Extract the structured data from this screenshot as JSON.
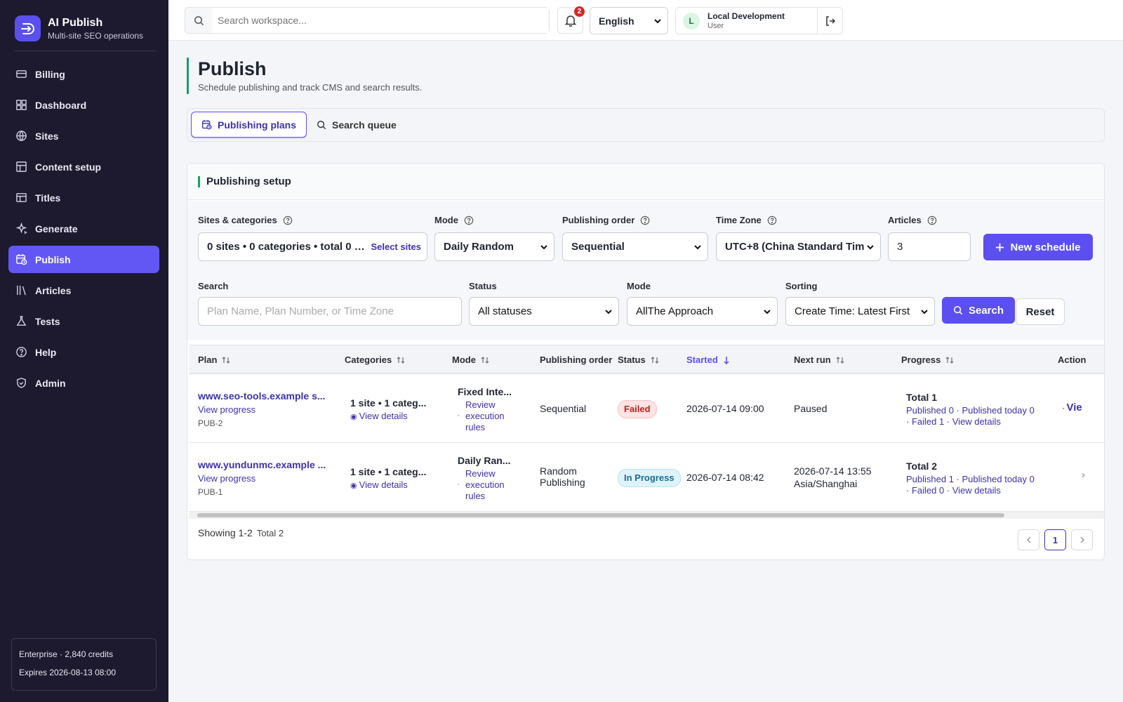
{
  "app": {
    "title": "AI Publish",
    "subtitle": "Multi-site SEO operations"
  },
  "sidebar": {
    "items": [
      {
        "label": "Billing",
        "icon": "billing-icon"
      },
      {
        "label": "Dashboard",
        "icon": "dashboard-icon"
      },
      {
        "label": "Sites",
        "icon": "globe-icon"
      },
      {
        "label": "Content setup",
        "icon": "layout-icon"
      },
      {
        "label": "Titles",
        "icon": "table-icon"
      },
      {
        "label": "Generate",
        "icon": "sparkle-icon"
      },
      {
        "label": "Publish",
        "icon": "calendar-clock-icon",
        "active": true
      },
      {
        "label": "Articles",
        "icon": "library-icon"
      },
      {
        "label": "Tests",
        "icon": "flask-icon"
      },
      {
        "label": "Help",
        "icon": "help-icon"
      },
      {
        "label": "Admin",
        "icon": "shield-icon"
      }
    ],
    "plan": {
      "line1": "Enterprise · 2,840 credits",
      "line2": "Expires 2026-08-13 08:00"
    }
  },
  "topbar": {
    "search_placeholder": "Search workspace...",
    "notifications_count": "2",
    "language": "English",
    "user": {
      "initial": "L",
      "name": "Local Development",
      "role": "User"
    }
  },
  "page": {
    "title": "Publish",
    "subtitle": "Schedule publishing and track CMS and search results."
  },
  "tabs": [
    {
      "label": "Publishing plans",
      "active": true
    },
    {
      "label": "Search queue",
      "active": false
    }
  ],
  "setup": {
    "title": "Publishing setup",
    "sites_label": "Sites & categories",
    "sites_value": "0 sites • 0 categories • total 0 r...",
    "select_sites": "Select sites",
    "mode_label": "Mode",
    "mode_value": "Daily Random",
    "order_label": "Publishing order",
    "order_value": "Sequential",
    "tz_label": "Time Zone",
    "tz_value": "UTC+8 (China Standard Tim",
    "articles_label": "Articles",
    "articles_value": "3",
    "new_schedule": "New schedule"
  },
  "filters": {
    "search_label": "Search",
    "search_placeholder": "Plan Name, Plan Number, or Time Zone",
    "status_label": "Status",
    "status_value": "All statuses",
    "mode_label": "Mode",
    "mode_value": "AllThe Approach",
    "sorting_label": "Sorting",
    "sorting_value": "Create Time: Latest First",
    "search_button": "Search",
    "reset_button": "Reset"
  },
  "table": {
    "headers": {
      "plan": "Plan",
      "categories": "Categories",
      "mode": "Mode",
      "order": "Publishing order",
      "status": "Status",
      "started": "Started",
      "next_run": "Next run",
      "progress": "Progress",
      "actions": "Action"
    },
    "rows": [
      {
        "plan": "www.seo-tools.example s...",
        "view_progress": "View progress",
        "id": "PUB-2",
        "categories": "1 site • 1 categ...",
        "view_details": "View details",
        "mode": "Fixed Inte...",
        "rules": "Review execution rules",
        "order": "Sequential",
        "status": "Failed",
        "status_kind": "failed",
        "started": "2026-07-14 09:00",
        "next_run": "Paused",
        "next_run_tz": "",
        "total": "Total 1",
        "progress_line1": "Published 0 · Published today 0",
        "progress_line2": "· Failed 1 · View details",
        "action": "Vie"
      },
      {
        "plan": "www.yundunmc.example ...",
        "view_progress": "View progress",
        "id": "PUB-1",
        "categories": "1 site • 1 categ...",
        "view_details": "View details",
        "mode": "Daily Ran...",
        "rules": "Review execution rules",
        "order": "Random Publishing",
        "status": "In Progress",
        "status_kind": "progress",
        "started": "2026-07-14 08:42",
        "next_run": "2026-07-14 13:55",
        "next_run_tz": "Asia/Shanghai",
        "total": "Total 2",
        "progress_line1": "Published 1 · Published today 0",
        "progress_line2": "· Failed 0 · View details",
        "action": "›"
      }
    ],
    "showing": "Showing 1-2",
    "total": "Total 2",
    "page": "1"
  }
}
